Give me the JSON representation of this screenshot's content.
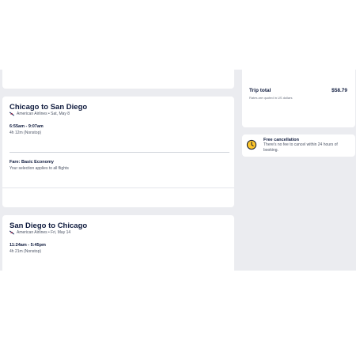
{
  "outbound": {
    "title": "Chicago to San Diego",
    "meta": "American Airlines • Sat, May 8",
    "time": "6:55am - 9:07am",
    "duration": "4h 12m (Nonstop)",
    "fare_label": "Fare: Basic Economy",
    "fare_note": "Your selection applies to all flights"
  },
  "return": {
    "title": "San Diego to Chicago",
    "meta": "American Airlines • Fri, May 14",
    "time": "11:24am - 5:45pm",
    "duration": "4h 21m (Nonstop)"
  },
  "trip_total": {
    "label": "Trip total",
    "amount": "$58.79",
    "note": "Rates are quoted in US dollars"
  },
  "free_cancellation": {
    "title": "Free cancellation",
    "text_line1": "There's no fee to cancel within 24 hours of",
    "text_line2": "booking."
  },
  "colors": {
    "panel_bg": "#ebecf0",
    "clock_yellow": "#ffc72c",
    "heading_navy": "#0e1a3d"
  },
  "icons": {
    "airline": "plane-icon",
    "cancellation": "clock-icon"
  }
}
